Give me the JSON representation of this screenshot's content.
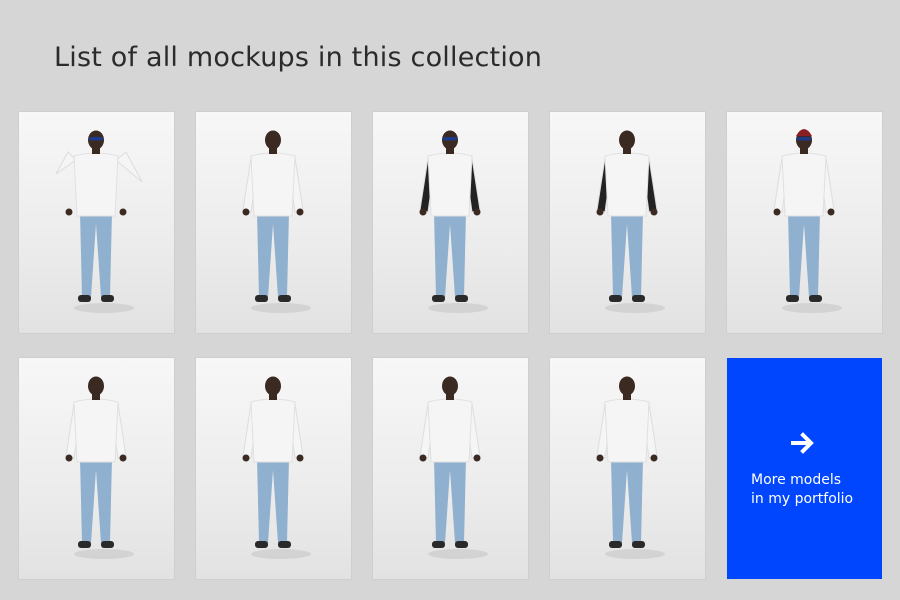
{
  "header": {
    "title": "List of all mockups in this collection"
  },
  "mockups": [
    {
      "pose": "front-hoodie-hands-up",
      "top_color": "#f5f5f5",
      "sleeve_color": "#f5f5f5"
    },
    {
      "pose": "back-hoodie",
      "top_color": "#f5f5f5",
      "sleeve_color": "#f5f5f5"
    },
    {
      "pose": "front-raglan",
      "top_color": "#f5f5f5",
      "sleeve_color": "#222222"
    },
    {
      "pose": "back-raglan",
      "top_color": "#f5f5f5",
      "sleeve_color": "#222222"
    },
    {
      "pose": "front-longsleeve-beanie",
      "top_color": "#f5f5f5",
      "sleeve_color": "#f5f5f5"
    },
    {
      "pose": "back-longsleeve",
      "top_color": "#f5f5f5",
      "sleeve_color": "#f5f5f5"
    },
    {
      "pose": "front-longsleeve-looking-down",
      "top_color": "#f5f5f5",
      "sleeve_color": "#f5f5f5"
    },
    {
      "pose": "back-longsleeve-hands-hips",
      "top_color": "#f5f5f5",
      "sleeve_color": "#f5f5f5"
    },
    {
      "pose": "front-longsleeve-standing",
      "top_color": "#f5f5f5",
      "sleeve_color": "#f5f5f5"
    }
  ],
  "cta": {
    "icon": "arrow-right-icon",
    "label": "More models\nin my portfolio",
    "color": "#0046ff"
  },
  "colors": {
    "background": "#d6d6d6",
    "skin": "#3a2a22",
    "jeans": "#8fb0cf",
    "shoes": "#2a2a2a"
  }
}
